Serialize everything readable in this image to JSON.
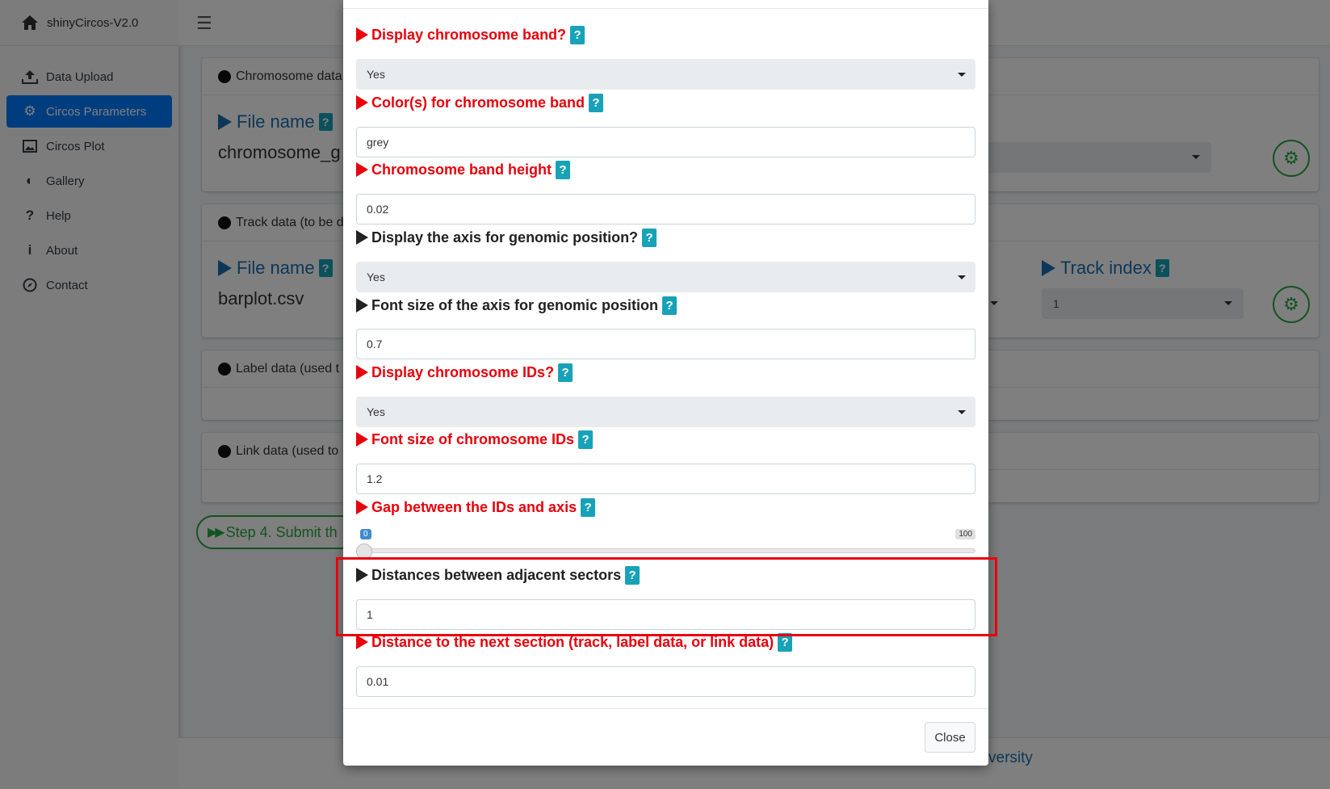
{
  "app": {
    "brand": "shinyCircos-V2.0"
  },
  "sidebar": {
    "items": [
      {
        "label": "Data Upload",
        "icon": "upload-icon"
      },
      {
        "label": "Circos Parameters",
        "icon": "cogs-icon",
        "active": true
      },
      {
        "label": "Circos Plot",
        "icon": "image-icon"
      },
      {
        "label": "Gallery",
        "icon": "adjust-icon"
      },
      {
        "label": "Help",
        "icon": "question-icon"
      },
      {
        "label": "About",
        "icon": "info-icon"
      },
      {
        "label": "Contact",
        "icon": "compass-icon"
      }
    ]
  },
  "background": {
    "chromosome_card": {
      "header": "Chromosome data",
      "file_label": "File name",
      "file_value": "chromosome_g"
    },
    "track_card": {
      "header": "Track data (to be d",
      "file_label": "File name",
      "file_value": "barplot.csv",
      "track_index_label": "Track index",
      "track_index_value": "1"
    },
    "label_card": {
      "header": "Label data (used t"
    },
    "link_card": {
      "header": "Link data (used to"
    },
    "step_button": "Step 4. Submit th",
    "footer_text": "versity"
  },
  "modal": {
    "fields": [
      {
        "label": "Display chromosome band?",
        "color": "red",
        "control": "select",
        "value": "Yes"
      },
      {
        "label": "Color(s) for chromosome band",
        "color": "red",
        "control": "input",
        "value": "grey"
      },
      {
        "label": "Chromosome band height",
        "color": "red",
        "control": "input",
        "value": "0.02"
      },
      {
        "label": "Display the axis for genomic position?",
        "color": "black",
        "control": "select",
        "value": "Yes"
      },
      {
        "label": "Font size of the axis for genomic position",
        "color": "black",
        "control": "input",
        "value": "0.7"
      },
      {
        "label": "Display chromosome IDs?",
        "color": "red",
        "control": "select",
        "value": "Yes"
      },
      {
        "label": "Font size of chromosome IDs",
        "color": "red",
        "control": "input",
        "value": "1.2"
      },
      {
        "label": "Gap between the IDs and axis",
        "color": "red",
        "control": "slider",
        "min": "0",
        "max": "100",
        "value": 0
      },
      {
        "label": "Distances between adjacent sectors",
        "color": "black",
        "control": "input",
        "value": "1"
      },
      {
        "label": "Distance to the next section (track, label data, or link data)",
        "color": "red",
        "control": "input",
        "value": "0.01"
      }
    ],
    "help_badge": "?",
    "close_label": "Close"
  },
  "colors": {
    "accent_red": "#e8000b",
    "primary": "#007bff",
    "info": "#17a2b8",
    "success": "#28a745"
  }
}
